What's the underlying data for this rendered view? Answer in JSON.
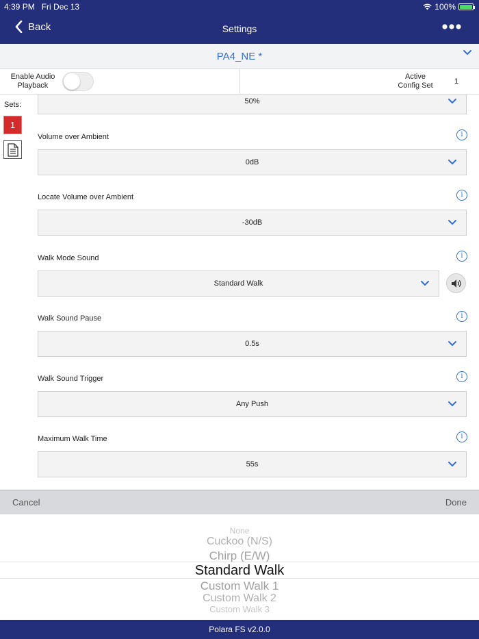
{
  "status_bar": {
    "time": "4:39 PM",
    "date": "Fri Dec 13",
    "battery": "100%",
    "battery_level": 1.0
  },
  "nav": {
    "back_label": "Back",
    "title": "Settings",
    "more_label": "•••"
  },
  "profile": {
    "name": "PA4_NE *"
  },
  "audio": {
    "enable_label_1": "Enable Audio",
    "enable_label_2": "Playback",
    "enabled": false,
    "active_label_1": "Active",
    "active_label_2": "Config Set",
    "active_value": "1"
  },
  "sets": {
    "label": "Sets:",
    "items": [
      "1"
    ]
  },
  "fields": [
    {
      "label": "",
      "value": "50%"
    },
    {
      "label": "Volume over Ambient",
      "value": "0dB"
    },
    {
      "label": "Locate Volume over Ambient",
      "value": "-30dB"
    },
    {
      "label": "Walk Mode Sound",
      "value": "Standard Walk"
    },
    {
      "label": "Walk Sound Pause",
      "value": "0.5s"
    },
    {
      "label": "Walk Sound Trigger",
      "value": "Any Push"
    },
    {
      "label": "Maximum Walk Time",
      "value": "55s"
    }
  ],
  "picker": {
    "cancel_label": "Cancel",
    "done_label": "Done",
    "options": [
      "None",
      "Cuckoo (N/S)",
      "Chirp (E/W)",
      "Standard Walk",
      "Custom Walk 1",
      "Custom Walk 2",
      "Custom Walk 3"
    ],
    "selected": "Standard Walk"
  },
  "footer": {
    "version": "Polara FS v2.0.0"
  },
  "colors": {
    "nav_bg": "#232f7b",
    "accent": "#2f6fd6",
    "set_active": "#d42a2a"
  }
}
